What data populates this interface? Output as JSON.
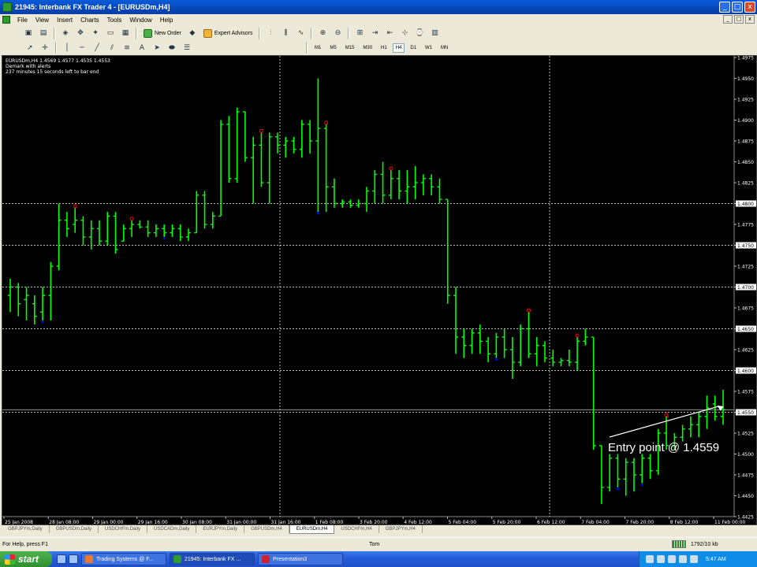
{
  "window": {
    "title": "21945: Interbank FX Trader 4 - [EURUSDm,H4]",
    "minimize": "_",
    "maximize": "□",
    "close": "x"
  },
  "menu": {
    "items": [
      "File",
      "View",
      "Insert",
      "Charts",
      "Tools",
      "Window",
      "Help"
    ],
    "mdi_minimize": "_",
    "mdi_restore": "□",
    "mdi_close": "x"
  },
  "toolbar": {
    "new_order": "New Order",
    "expert_advisors": "Expert Advisors",
    "timeframes": [
      "M1",
      "M5",
      "M15",
      "M30",
      "H1",
      "H4",
      "D1",
      "W1",
      "MN"
    ],
    "active_timeframe": "H4"
  },
  "chart": {
    "info_line1": "EURUSDm,H4 1.4569 1.4577 1.4535 1.4553",
    "info_line2": "Demark with alerts",
    "info_line3": "237 minutes 15 seconds left to bar end",
    "annotation": "Entry point @ 1.4559",
    "current_price_label": "1.4553",
    "colors": {
      "background": "#000000",
      "bars": "#00ff00",
      "grid": "#ffffff",
      "upper_fractal": "#ff0000",
      "lower_fractal": "#0000ff",
      "annotation": "#ffffff"
    }
  },
  "chart_data": {
    "type": "ohlc",
    "symbol": "EURUSDm",
    "timeframe": "H4",
    "ylim": [
      1.4425,
      1.4975
    ],
    "y_ticks": [
      1.4975,
      1.495,
      1.4925,
      1.49,
      1.4875,
      1.485,
      1.4825,
      1.48,
      1.4775,
      1.475,
      1.4725,
      1.47,
      1.4675,
      1.465,
      1.4625,
      1.46,
      1.4575,
      1.455,
      1.4525,
      1.45,
      1.4475,
      1.445,
      1.4425
    ],
    "highlighted_prices": [
      1.48,
      1.475,
      1.47,
      1.465,
      1.46,
      1.455
    ],
    "current_price": 1.4553,
    "x_labels": [
      "25 Jan 2008",
      "28 Jan 08:00",
      "29 Jan 00:00",
      "29 Jan 16:00",
      "30 Jan 08:00",
      "31 Jan 00:00",
      "31 Jan 16:00",
      "1 Feb 08:00",
      "3 Feb 20:00",
      "4 Feb 12:00",
      "5 Feb 04:00",
      "5 Feb 20:00",
      "6 Feb 12:00",
      "7 Feb 04:00",
      "7 Feb 20:00",
      "8 Feb 12:00",
      "11 Feb 00:00"
    ],
    "bars": [
      [
        1.469,
        1.471,
        1.467,
        1.47
      ],
      [
        1.47,
        1.4705,
        1.4665,
        1.468
      ],
      [
        1.4685,
        1.47,
        1.466,
        1.469
      ],
      [
        1.468,
        1.469,
        1.4655,
        1.4665
      ],
      [
        1.467,
        1.47,
        1.466,
        1.469
      ],
      [
        1.469,
        1.473,
        1.466,
        1.4725
      ],
      [
        1.4725,
        1.48,
        1.472,
        1.478
      ],
      [
        1.478,
        1.479,
        1.476,
        1.477
      ],
      [
        1.4775,
        1.4795,
        1.4765,
        1.478
      ],
      [
        1.478,
        1.4785,
        1.475,
        1.476
      ],
      [
        1.476,
        1.478,
        1.4745,
        1.477
      ],
      [
        1.477,
        1.478,
        1.475,
        1.4755
      ],
      [
        1.4755,
        1.479,
        1.475,
        1.4785
      ],
      [
        1.4785,
        1.479,
        1.474,
        1.4745
      ],
      [
        1.4755,
        1.4775,
        1.4755,
        1.477
      ],
      [
        1.477,
        1.478,
        1.476,
        1.4775
      ],
      [
        1.4775,
        1.478,
        1.477,
        1.4772
      ],
      [
        1.4772,
        1.478,
        1.476,
        1.4765
      ],
      [
        1.4765,
        1.4775,
        1.476,
        1.477
      ],
      [
        1.477,
        1.4775,
        1.476,
        1.4765
      ],
      [
        1.4765,
        1.4775,
        1.476,
        1.477
      ],
      [
        1.477,
        1.4775,
        1.4755,
        1.476
      ],
      [
        1.476,
        1.477,
        1.4755,
        1.4765
      ],
      [
        1.4765,
        1.4815,
        1.4765,
        1.481
      ],
      [
        1.481,
        1.4815,
        1.477,
        1.4775
      ],
      [
        1.4775,
        1.479,
        1.477,
        1.4785
      ],
      [
        1.4785,
        1.49,
        1.4785,
        1.4895
      ],
      [
        1.4895,
        1.4905,
        1.4825,
        1.483
      ],
      [
        1.483,
        1.4915,
        1.4825,
        1.491
      ],
      [
        1.491,
        1.491,
        1.485,
        1.4855
      ],
      [
        1.4855,
        1.488,
        1.48,
        1.487
      ],
      [
        1.487,
        1.4885,
        1.482,
        1.4825
      ],
      [
        1.4825,
        1.4885,
        1.48,
        1.488
      ],
      [
        1.488,
        1.4885,
        1.486,
        1.487
      ],
      [
        1.487,
        1.488,
        1.4855,
        1.4875
      ],
      [
        1.4875,
        1.488,
        1.486,
        1.4865
      ],
      [
        1.4865,
        1.49,
        1.4855,
        1.4895
      ],
      [
        1.4895,
        1.49,
        1.486,
        1.4875
      ],
      [
        1.4875,
        1.495,
        1.479,
        1.489
      ],
      [
        1.489,
        1.4895,
        1.479,
        1.482
      ],
      [
        1.482,
        1.483,
        1.4795,
        1.48
      ],
      [
        1.48,
        1.4805,
        1.4795,
        1.4802
      ],
      [
        1.4802,
        1.4805,
        1.4795,
        1.4798
      ],
      [
        1.4798,
        1.4805,
        1.4795,
        1.48
      ],
      [
        1.48,
        1.482,
        1.479,
        1.4815
      ],
      [
        1.4815,
        1.484,
        1.48,
        1.4835
      ],
      [
        1.4835,
        1.485,
        1.48,
        1.481
      ],
      [
        1.481,
        1.484,
        1.4805,
        1.483
      ],
      [
        1.483,
        1.484,
        1.4805,
        1.4815
      ],
      [
        1.4815,
        1.484,
        1.48,
        1.482
      ],
      [
        1.482,
        1.4845,
        1.4805,
        1.4825
      ],
      [
        1.4825,
        1.4835,
        1.481,
        1.483
      ],
      [
        1.483,
        1.4835,
        1.481,
        1.482
      ],
      [
        1.482,
        1.483,
        1.48,
        1.4805
      ],
      [
        1.4805,
        1.4805,
        1.468,
        1.469
      ],
      [
        1.469,
        1.47,
        1.462,
        1.464
      ],
      [
        1.464,
        1.465,
        1.4615,
        1.463
      ],
      [
        1.463,
        1.465,
        1.462,
        1.4645
      ],
      [
        1.4645,
        1.4655,
        1.462,
        1.4635
      ],
      [
        1.4635,
        1.464,
        1.461,
        1.462
      ],
      [
        1.462,
        1.4645,
        1.4615,
        1.464
      ],
      [
        1.464,
        1.465,
        1.4615,
        1.4625
      ],
      [
        1.4625,
        1.464,
        1.459,
        1.461
      ],
      [
        1.461,
        1.4655,
        1.4605,
        1.465
      ],
      [
        1.465,
        1.467,
        1.4615,
        1.462
      ],
      [
        1.462,
        1.464,
        1.4605,
        1.463
      ],
      [
        1.463,
        1.4635,
        1.461,
        1.4615
      ],
      [
        1.4615,
        1.4625,
        1.4605,
        1.461
      ],
      [
        1.461,
        1.4615,
        1.4605,
        1.4612
      ],
      [
        1.4612,
        1.4625,
        1.4605,
        1.461
      ],
      [
        1.461,
        1.464,
        1.46,
        1.4635
      ],
      [
        1.4635,
        1.465,
        1.463,
        1.464
      ],
      [
        1.464,
        1.464,
        1.4505,
        1.451
      ],
      [
        1.451,
        1.451,
        1.444,
        1.446
      ],
      [
        1.446,
        1.45,
        1.4455,
        1.4495
      ],
      [
        1.4495,
        1.45,
        1.446,
        1.447
      ],
      [
        1.447,
        1.4495,
        1.445,
        1.449
      ],
      [
        1.449,
        1.4495,
        1.4455,
        1.4475
      ],
      [
        1.4475,
        1.45,
        1.4465,
        1.4495
      ],
      [
        1.4495,
        1.45,
        1.447,
        1.448
      ],
      [
        1.448,
        1.453,
        1.4475,
        1.4525
      ],
      [
        1.4525,
        1.4545,
        1.4505,
        1.451
      ],
      [
        1.451,
        1.4525,
        1.4505,
        1.452
      ],
      [
        1.452,
        1.4535,
        1.4515,
        1.453
      ],
      [
        1.453,
        1.4545,
        1.452,
        1.4535
      ],
      [
        1.4535,
        1.455,
        1.452,
        1.4545
      ],
      [
        1.4545,
        1.457,
        1.453,
        1.4555
      ],
      [
        1.456,
        1.457,
        1.454,
        1.4545
      ],
      [
        1.4545,
        1.4577,
        1.4535,
        1.4553
      ]
    ],
    "upper_fractals": [
      8,
      15,
      31,
      39,
      47,
      64,
      70,
      81
    ],
    "lower_fractals": [
      4,
      19,
      38,
      60,
      75,
      78
    ]
  },
  "tabs": {
    "items": [
      "GBPJPYm,Daily",
      "GBPUSDm,Daily",
      "USDCHFm,Daily",
      "USDCADm,Daily",
      "EURJPYm,Daily",
      "GBPUSDm,H4",
      "EURUSDm,H4",
      "USDCHFm,H4",
      "GBPJPYm,H4"
    ],
    "active": "EURUSDm,H4"
  },
  "status": {
    "help_text": "For Help, press F1",
    "profile": "Tom",
    "connection": "1792/10 kb"
  },
  "taskbar": {
    "start_label": "start",
    "tasks": [
      "Trading Systems @ F...",
      "21945: Interbank FX ...",
      "Presentation3"
    ],
    "clock": "5:47 AM"
  }
}
